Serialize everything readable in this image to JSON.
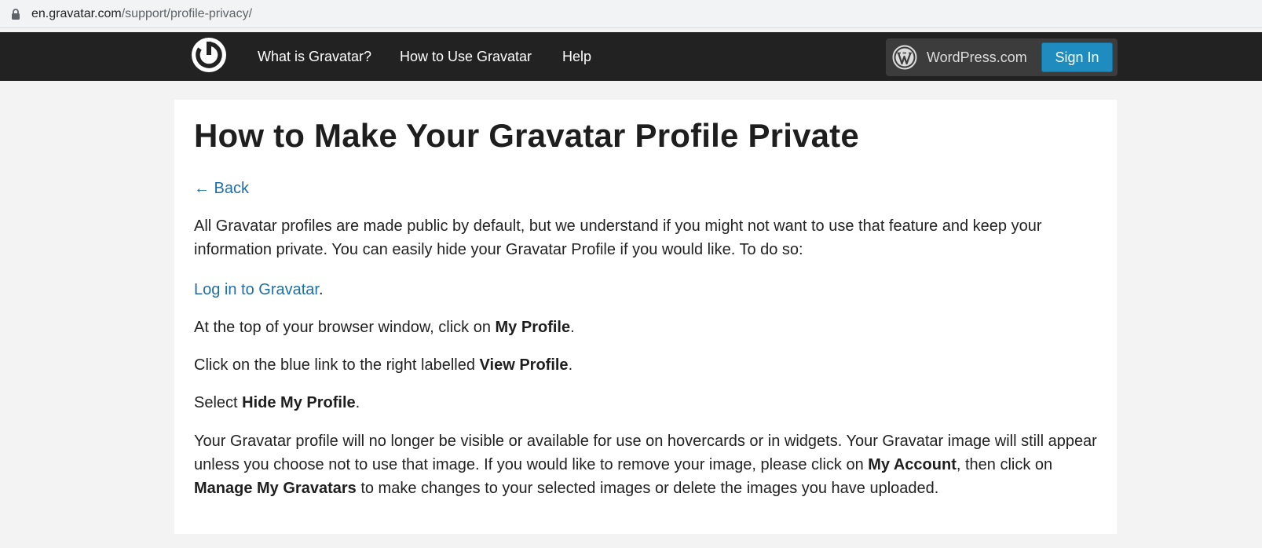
{
  "browser": {
    "url_host": "en.gravatar.com",
    "url_path": "/support/profile-privacy/",
    "lock_icon": "lock-icon"
  },
  "header": {
    "logo_icon": "gravatar-logo-icon",
    "nav": [
      {
        "label": "What is Gravatar?"
      },
      {
        "label": "How to Use Gravatar"
      },
      {
        "label": "Help"
      }
    ],
    "wordpress_label": "WordPress.com",
    "wordpress_icon": "wordpress-logo-icon",
    "signin_label": "Sign In"
  },
  "article": {
    "title": "How to Make Your Gravatar Profile Private",
    "back_label": "← Back",
    "intro": "All Gravatar profiles are made public by default, but we understand if you might not want to use that feature and keep your information private. You can easily hide your Gravatar Profile if you would like. To do so:",
    "step1_link": "Log in to Gravatar",
    "step1_suffix": ".",
    "step2_prefix": "At the top of your browser window, click on ",
    "step2_bold": "My Profile",
    "step2_suffix": ".",
    "step3_prefix": "Click on the blue link to the right labelled ",
    "step3_bold": "View Profile",
    "step3_suffix": ".",
    "step4_prefix": "Select ",
    "step4_bold": "Hide My Profile",
    "step4_suffix": ".",
    "outro_a": "Your Gravatar profile will no longer be visible or available for use on hovercards or in widgets. Your Gravatar image will still appear unless you choose not to use that image. If you would like to remove your image, please click on ",
    "outro_bold1": "My Account",
    "outro_b": ", then click on ",
    "outro_bold2": "Manage My Gravatars",
    "outro_c": " to make changes to your selected images or delete the images you have uploaded."
  },
  "colors": {
    "header_bg": "#222222",
    "link": "#1e6fa6",
    "signin_bg": "#1e8cbe",
    "page_bg": "#f3f3f3"
  }
}
